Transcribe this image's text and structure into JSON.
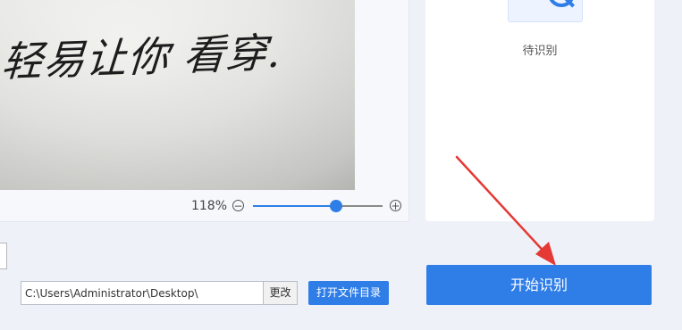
{
  "image_preview": {
    "handwriting_text": "轻易让你 看穿."
  },
  "zoom": {
    "label": "118%",
    "value_percent": 118,
    "slider_fraction": 0.64,
    "minus_icon": "zoom-out-icon",
    "plus_icon": "zoom-in-icon"
  },
  "result_panel": {
    "status": "待识别",
    "icon": "document-magnifier-icon"
  },
  "output": {
    "path_value": "C:\\Users\\Administrator\\Desktop\\",
    "change_label": "更改",
    "open_dir_label": "打开文件目录"
  },
  "actions": {
    "start_label": "开始识别"
  },
  "colors": {
    "accent": "#2f7ee8",
    "annotation_arrow": "#e53935"
  }
}
